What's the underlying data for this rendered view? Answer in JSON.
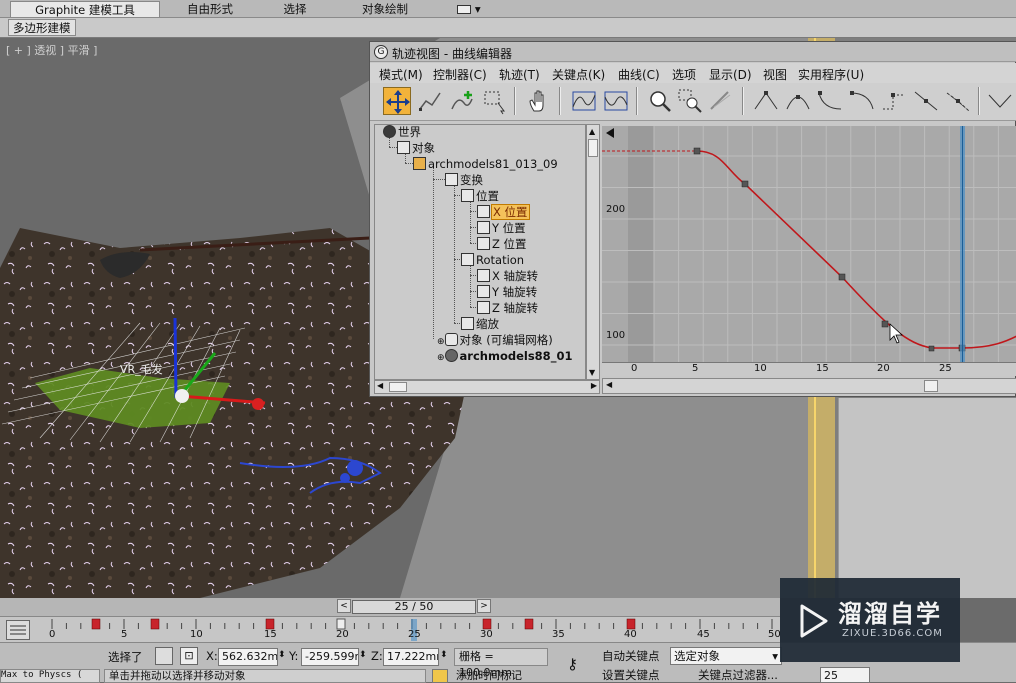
{
  "ribbon": {
    "tabs": [
      "Graphite 建模工具",
      "自由形式",
      "选择",
      "对象绘制"
    ],
    "sub_button": "多边形建模"
  },
  "viewport": {
    "label": "[ + ] 透视 ] 平滑 ]",
    "object_label": "VR_毛发"
  },
  "trackview": {
    "title": "轨迹视图 - 曲线编辑器",
    "menu": [
      "模式(M)",
      "控制器(C)",
      "轨迹(T)",
      "关键点(K)",
      "曲线(C)",
      "选项",
      "显示(D)",
      "视图",
      "实用程序(U)"
    ],
    "tree": [
      {
        "label": "世界",
        "icon": "globe-icon"
      },
      {
        "label": "对象",
        "icon": "object-icon"
      },
      {
        "label": "archmodels81_013_09",
        "icon": "box-icon"
      },
      {
        "label": "变换",
        "icon": "transform-icon"
      },
      {
        "label": "位置",
        "icon": "position-icon"
      },
      {
        "label": "X 位置",
        "icon": "curve-icon",
        "selected": true
      },
      {
        "label": "Y 位置",
        "icon": "curve-icon"
      },
      {
        "label": "Z 位置",
        "icon": "curve-icon"
      },
      {
        "label": "Rotation",
        "icon": "rotation-icon"
      },
      {
        "label": "X 轴旋转",
        "icon": "curve-icon"
      },
      {
        "label": "Y 轴旋转",
        "icon": "curve-icon"
      },
      {
        "label": "Z 轴旋转",
        "icon": "curve-icon"
      },
      {
        "label": "缩放",
        "icon": "scale-icon"
      },
      {
        "label": "对象 (可编辑网格)",
        "icon": "mesh-icon"
      },
      {
        "label": "archmodels88_01",
        "icon": "sphere-icon",
        "bold": true
      }
    ],
    "curve": {
      "y_ticks": [
        "200",
        "100"
      ],
      "x_ticks": [
        "0",
        "5",
        "10",
        "15",
        "20",
        "25"
      ],
      "curve_color": "#c0171b",
      "current_frame": 25
    }
  },
  "timeline": {
    "frame_display": "25 / 50",
    "ticks": [
      "0",
      "5",
      "10",
      "15",
      "20",
      "25",
      "30",
      "35",
      "40",
      "45",
      "50"
    ]
  },
  "status": {
    "selected_label": "选择了",
    "x_label": "X:",
    "x_value": "562.632mr",
    "y_label": "Y:",
    "y_value": "-259.599m",
    "z_label": "Z:",
    "z_value": "17.222mm",
    "grid": "栅格 = 100.0mm",
    "auto_key": "自动关键点",
    "selected_object": "选定对象",
    "set_key": "设置关键点",
    "key_filter": "关键点过滤器...",
    "prompt": "单击并拖动以选择并移动对象",
    "add_time_tag": "添加时间标记",
    "maxscript": "Max to Physcs (",
    "frame_field": "25"
  },
  "watermark": {
    "title": "溜溜自学",
    "url": "ZIXUE.3D66.COM"
  }
}
